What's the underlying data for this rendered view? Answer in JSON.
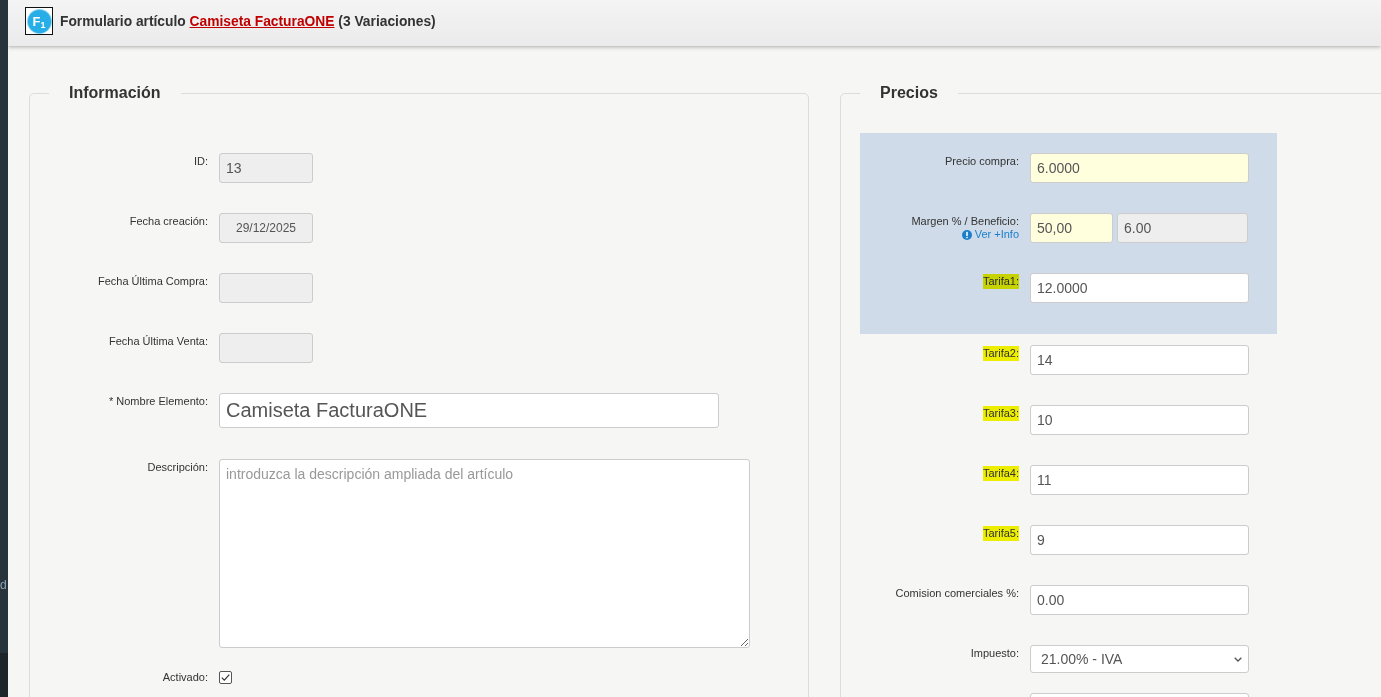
{
  "sidebar": {
    "text": "d"
  },
  "header": {
    "logo_text": "F$_{1}$",
    "title_prefix": "Formulario artículo",
    "title_link": "Camiseta FacturaONE",
    "title_suffix": "(3 Variaciones)"
  },
  "informacion": {
    "legend": "Información",
    "fields": [
      {
        "kind": "short",
        "label": "ID:",
        "value": "13",
        "disabled": true
      },
      {
        "kind": "date",
        "label": "Fecha creación:",
        "value": "29/12/2025",
        "disabled": true
      },
      {
        "kind": "date",
        "label": "Fecha Última Compra:",
        "disabled": true
      },
      {
        "kind": "date",
        "label": "Fecha Última Venta:",
        "disabled": true
      },
      {
        "kind": "name",
        "label": "* Nombre Elemento:",
        "value": "Camiseta FacturaONE",
        "disabled": false
      },
      {
        "kind": "textarea",
        "label": "Descripción:",
        "placeholder": "introduzca la descripción ampliada del artículo"
      },
      {
        "kind": "checkbox",
        "label": "Activado:",
        "checked": true
      }
    ]
  },
  "precios": {
    "legend": "Precios",
    "panel_fields": [
      {
        "kind": "input",
        "label": "Precio compra:",
        "marked": false,
        "inputs": [
          {
            "value": "6.0000",
            "disabled": false,
            "highlighted": true
          }
        ]
      },
      {
        "kind": "input",
        "label": "Margen % / Beneficio:",
        "marked": false,
        "link": "Ver +Info",
        "inputs": [
          {
            "value": "50,00",
            "disabled": false,
            "highlighted": true
          },
          {
            "value": "6.00",
            "disabled": true,
            "highlighted": false
          }
        ]
      },
      {
        "kind": "input",
        "label": "Tarifa1:",
        "marked": true,
        "inputs": [
          {
            "value": "12.0000",
            "disabled": false,
            "highlighted": false
          }
        ]
      }
    ],
    "fields": [
      {
        "kind": "input",
        "label": "Tarifa2:",
        "marked": true,
        "inputs": [
          {
            "value": "14",
            "disabled": false,
            "highlighted": false
          }
        ]
      },
      {
        "kind": "input",
        "label": "Tarifa3:",
        "marked": true,
        "inputs": [
          {
            "value": "10",
            "disabled": false,
            "highlighted": false
          }
        ]
      },
      {
        "kind": "input",
        "label": "Tarifa4:",
        "marked": true,
        "inputs": [
          {
            "value": "11",
            "disabled": false,
            "highlighted": false
          }
        ]
      },
      {
        "kind": "input",
        "label": "Tarifa5:",
        "marked": true,
        "inputs": [
          {
            "value": "9",
            "disabled": false,
            "highlighted": false
          }
        ]
      },
      {
        "kind": "input",
        "label": "Comision comerciales %:",
        "marked": false,
        "inputs": [
          {
            "value": "0.00",
            "disabled": false,
            "highlighted": false
          }
        ]
      },
      {
        "kind": "select",
        "label": "Impuesto:",
        "marked": false,
        "value": "21.00% - IVA"
      },
      {
        "kind": "input"
      }
    ]
  }
}
